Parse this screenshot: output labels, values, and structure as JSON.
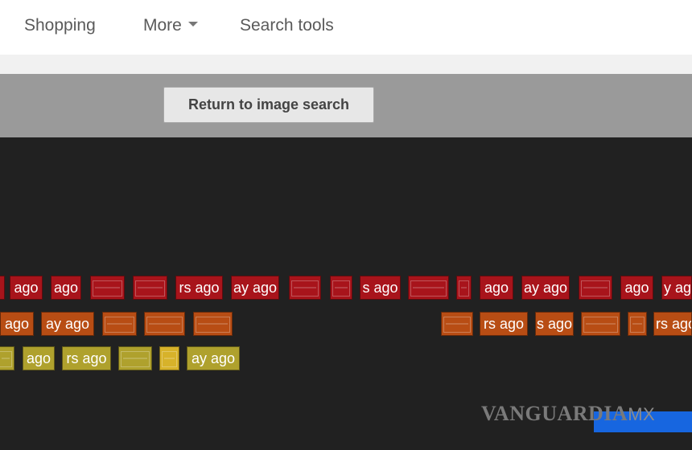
{
  "nav": {
    "shopping": "Shopping",
    "more": "More",
    "search_tools": "Search tools"
  },
  "toolbar": {
    "return_label": "Return to image search"
  },
  "colors": {
    "red_row": "#a8141b",
    "orange_row": "#b84d14",
    "yellow_row": "#afa12d",
    "accent_blue": "#1766e0"
  },
  "timeline": {
    "row1": [
      "ago",
      "ago",
      "rs ago",
      "ay ago",
      "s ago",
      "ago",
      "ay ago",
      "ago",
      "y ag"
    ],
    "row2": [
      "ago",
      "ay ago",
      "rs ago",
      "s ago",
      "rs ago"
    ],
    "row3": [
      "ago",
      "rs ago",
      "ay ago"
    ]
  },
  "watermark": {
    "text": "VANGUARDIA",
    "suffix": "MX"
  }
}
